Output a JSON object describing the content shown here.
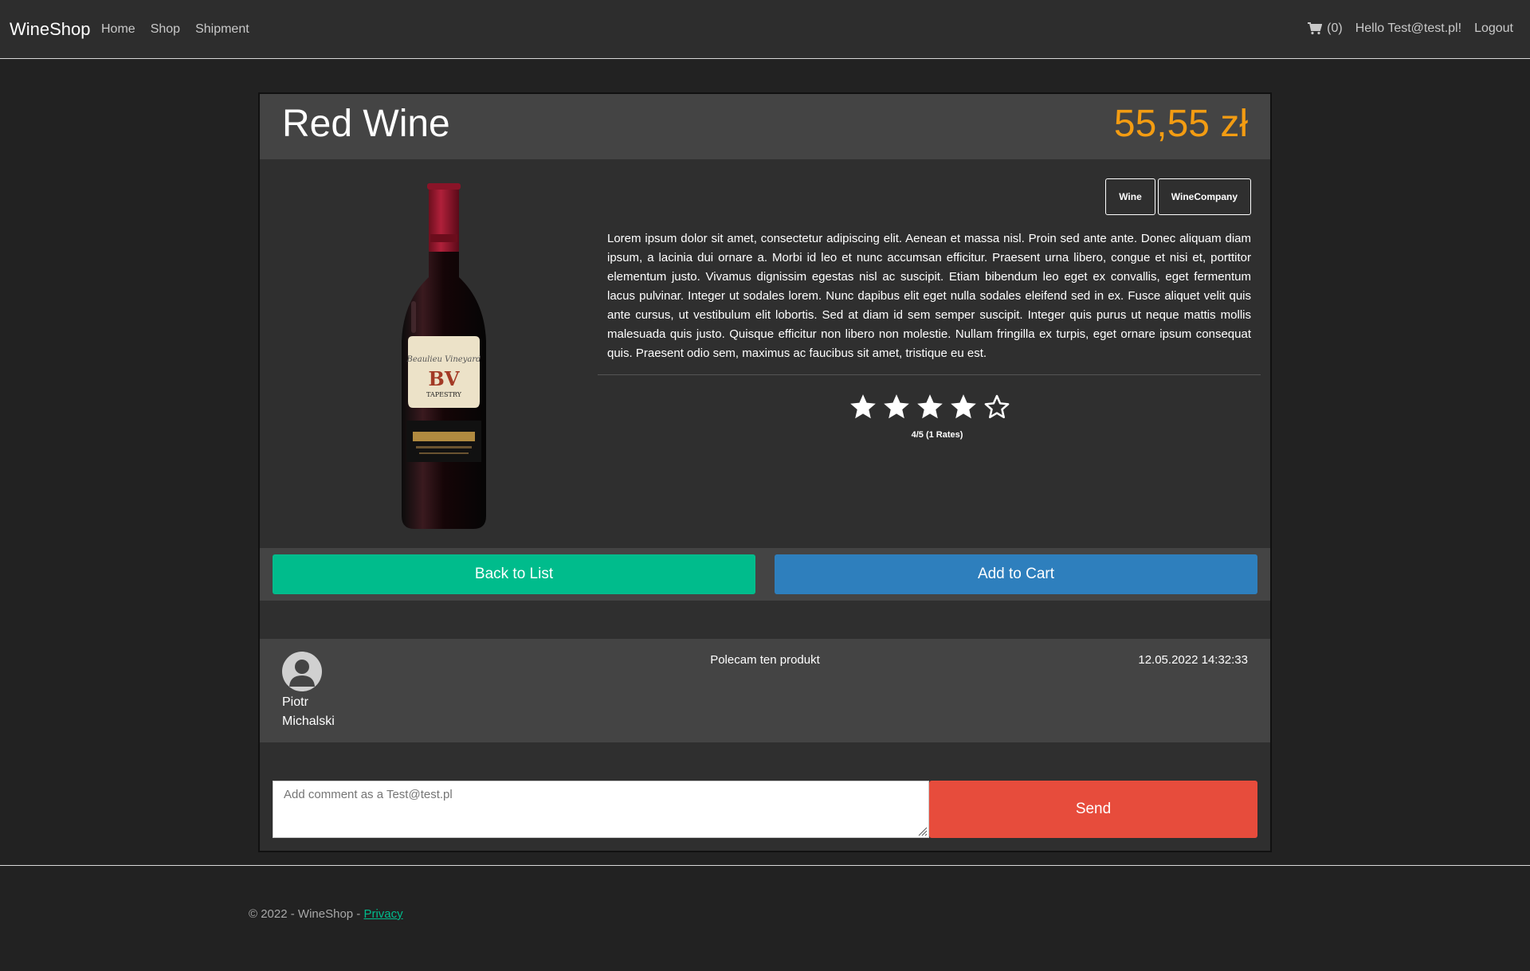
{
  "navbar": {
    "brand": "WineShop",
    "links": [
      "Home",
      "Shop",
      "Shipment"
    ],
    "cart_count": "(0)",
    "greeting": "Hello Test@test.pl!",
    "logout": "Logout"
  },
  "product": {
    "title": "Red Wine",
    "price": "55,55 zł",
    "tags": [
      "Wine",
      "WineCompany"
    ],
    "description": "Lorem ipsum dolor sit amet, consectetur adipiscing elit. Aenean et massa nisl. Proin sed ante ante. Donec aliquam diam ipsum, a lacinia dui ornare a. Morbi id leo et nunc accumsan efficitur. Praesent urna libero, congue et nisi et, porttitor elementum justo. Vivamus dignissim egestas nisl ac suscipit. Etiam bibendum leo eget ex convallis, eget fermentum lacus pulvinar. Integer ut sodales lorem. Nunc dapibus elit eget nulla sodales eleifend sed in ex. Fusce aliquet velit quis ante cursus, ut vestibulum elit lobortis. Sed at diam id sem semper suscipit. Integer quis purus ut neque mattis mollis malesuada quis justo. Quisque efficitur non libero non molestie. Nullam fringilla ex turpis, eget ornare ipsum consequat quis. Praesent odio sem, maximus ac faucibus sit amet, tristique eu est.",
    "rating": 4,
    "rating_max": 5,
    "rating_text": "4/5 (1 Rates)",
    "label_brand": "BV",
    "label_name": "TAPESTRY"
  },
  "actions": {
    "back": "Back to List",
    "add_to_cart": "Add to Cart"
  },
  "comments": [
    {
      "first_name": "Piotr",
      "last_name": "Michalski",
      "text": "Polecam ten produkt",
      "date": "12.05.2022 14:32:33"
    }
  ],
  "comment_form": {
    "placeholder": "Add comment as a Test@test.pl",
    "send": "Send"
  },
  "footer": {
    "text": "© 2022 - WineShop - ",
    "privacy": "Privacy"
  },
  "colors": {
    "price": "#f39c12",
    "back_button": "#00bc8c",
    "cart_button": "#2e7fbd",
    "send_button": "#e74c3c"
  }
}
